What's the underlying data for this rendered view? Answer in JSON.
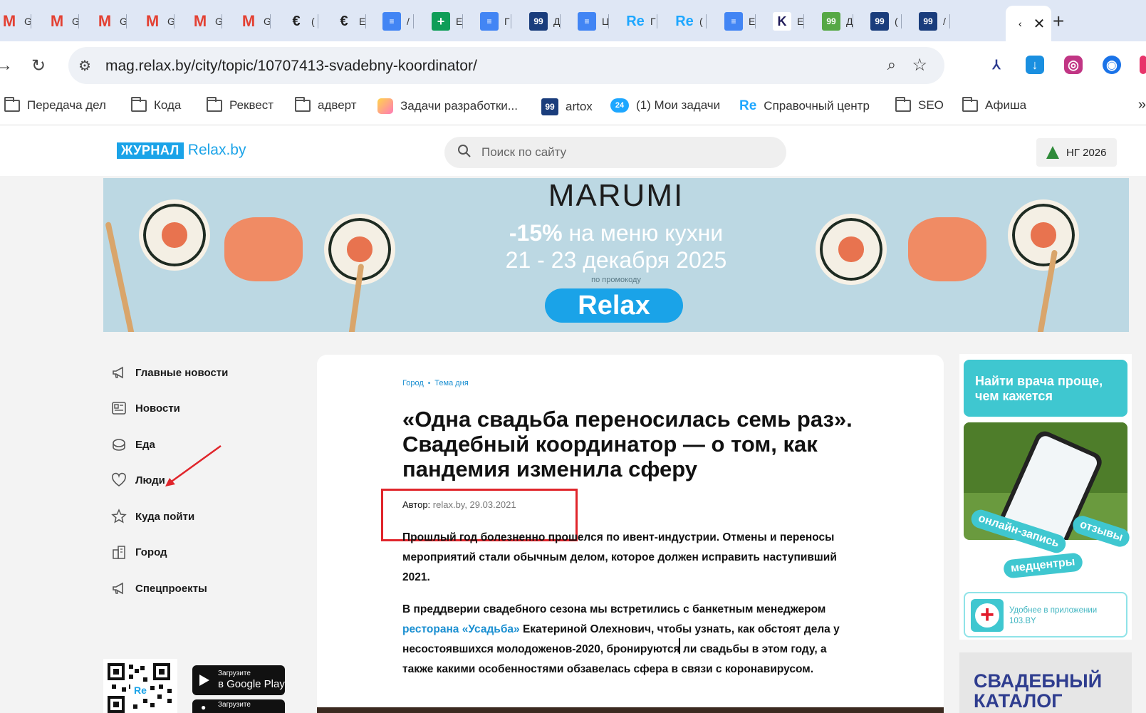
{
  "browser": {
    "tabs": [
      {
        "icon": "gmail-icon",
        "glyph": "M",
        "title": "G",
        "kind": "gm"
      },
      {
        "icon": "gmail-icon",
        "glyph": "M",
        "title": "G",
        "kind": "gm"
      },
      {
        "icon": "gmail-icon",
        "glyph": "M",
        "title": "G",
        "kind": "gm"
      },
      {
        "icon": "gmail-icon",
        "glyph": "M",
        "title": "G",
        "kind": "gm"
      },
      {
        "icon": "gmail-icon",
        "glyph": "M",
        "title": "G",
        "kind": "gm"
      },
      {
        "icon": "gmail-icon",
        "glyph": "M",
        "title": "G",
        "kind": "gm"
      },
      {
        "icon": "e-icon",
        "glyph": "€",
        "title": "(",
        "kind": "e"
      },
      {
        "icon": "e-icon",
        "glyph": "€",
        "title": "E",
        "kind": "e"
      },
      {
        "icon": "docs-icon",
        "glyph": "≡",
        "title": "/",
        "kind": "doc"
      },
      {
        "icon": "sheets-icon",
        "glyph": "+",
        "title": "E",
        "kind": "sheet"
      },
      {
        "icon": "docs-icon",
        "glyph": "≡",
        "title": "Γ",
        "kind": "doc"
      },
      {
        "icon": "99-icon",
        "glyph": "99",
        "title": "Д",
        "kind": "n99"
      },
      {
        "icon": "docs-icon",
        "glyph": "≡",
        "title": "Ц",
        "kind": "doc"
      },
      {
        "icon": "re-icon",
        "glyph": "Re",
        "title": "Γ",
        "kind": "re"
      },
      {
        "icon": "re-icon",
        "glyph": "Re",
        "title": "(",
        "kind": "re"
      },
      {
        "icon": "docs-icon",
        "glyph": "≡",
        "title": "E",
        "kind": "doc"
      },
      {
        "icon": "k-icon",
        "glyph": "K",
        "title": "E",
        "kind": "k"
      },
      {
        "icon": "99-icon",
        "glyph": "99",
        "title": "Д",
        "kind": "n99g"
      },
      {
        "icon": "99-icon",
        "glyph": "99",
        "title": "(",
        "kind": "n99"
      },
      {
        "icon": "99-icon",
        "glyph": "99",
        "title": "/",
        "kind": "n99"
      }
    ],
    "active_tab": {
      "title": "‹",
      "close": "✕"
    },
    "new_tab": "+",
    "url": "mag.relax.by/city/topic/10707413-svadebny-koordinator/",
    "bookmarks": [
      {
        "label": "Передача дел",
        "icon": "folder-icon"
      },
      {
        "label": "Кода",
        "icon": "folder-icon"
      },
      {
        "label": "Реквест",
        "icon": "folder-icon"
      },
      {
        "label": "адверт",
        "icon": "folder-icon"
      },
      {
        "label": "Задачи разработки...",
        "icon": "tasks-app-icon"
      },
      {
        "label": "artox",
        "icon": "99-icon",
        "glyph": "99"
      },
      {
        "label": "(1) Мои задачи",
        "icon": "bitrix24-icon",
        "glyph": "24"
      },
      {
        "label": "Справочный центр",
        "icon": "re-icon",
        "glyph": "Re"
      },
      {
        "label": "SEO",
        "icon": "folder-icon"
      },
      {
        "label": "Афиша",
        "icon": "folder-icon"
      }
    ],
    "bookmarks_more": "»"
  },
  "site": {
    "logo_mag": "ЖУРНАЛ",
    "logo_relax": "Relax.by",
    "search_placeholder": "Поиск по сайту",
    "ng_button": "НГ 2026"
  },
  "banner": {
    "brand": "MARUMI",
    "discount": "-15%",
    "promo_line1_rest": " на меню кухни",
    "promo_line2": "21 - 23 декабря 2025",
    "promo_by": "по промокоду",
    "promo_code": "Relax"
  },
  "left_nav": [
    {
      "label": "Главные новости",
      "icon": "megaphone-icon"
    },
    {
      "label": "Новости",
      "icon": "newspaper-icon"
    },
    {
      "label": "Еда",
      "icon": "food-icon"
    },
    {
      "label": "Люди",
      "icon": "heart-icon"
    },
    {
      "label": "Куда пойти",
      "icon": "star-icon"
    },
    {
      "label": "Город",
      "icon": "city-icon"
    },
    {
      "label": "Спецпроекты",
      "icon": "megaphone-icon"
    }
  ],
  "stores": {
    "google_small": "Загрузите",
    "google_big": "в Google Play",
    "apple_small": "Загрузите"
  },
  "qr_label": "Re",
  "article": {
    "crumbs": [
      "Город",
      "Тема дня"
    ],
    "headline": "«Одна свадьба переносилась семь раз». Свадебный координатор — о том, как пандемия изменила сферу",
    "author_label": "Автор:",
    "author_meta": " relax.by, 29.03.2021",
    "para1": "Прошлый год болезненно прошелся по ивент-индустрии. Отмены и переносы мероприятий стали обычным делом, которое должен исправить наступивший 2021.",
    "para2_before": "В преддверии свадебного сезона мы встретились с банкетным менеджером ",
    "para2_link": "ресторана «Усадьба»",
    "para2_after": " Екатериной Олехнович, чтобы узнать, как обстоят дела у несостоявшихся молодоженов-2020, бронируются ли свадьбы в этом году, а также какими особенностями обзавелась сфера в связи с коронавирусом."
  },
  "side_ad": {
    "headline": "Найти врача проще, чем кажется",
    "pill_booking": "онлайн-запись",
    "pill_reviews": "отзывы",
    "pill_clinics": "медцентры",
    "app_line1": "Удобнее в приложении",
    "app_line2": "103.BY"
  },
  "side_ad2": {
    "line1": "СВАДЕБНЫЙ",
    "line2": "КАТАЛОГ"
  },
  "colors": {
    "accent": "#1aa3e8",
    "annotation_red": "#e0252b",
    "sidebar_teal": "#3fc7d0"
  }
}
